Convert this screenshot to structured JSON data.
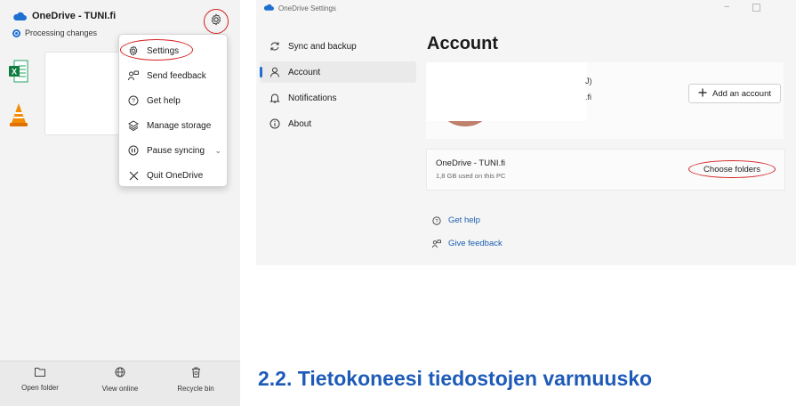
{
  "flyout": {
    "title": "OneDrive - TUNI.fi",
    "status": "Processing changes",
    "menu": {
      "items": [
        {
          "label": "Settings",
          "icon": "gear-icon"
        },
        {
          "label": "Send feedback",
          "icon": "feedback-icon"
        },
        {
          "label": "Get help",
          "icon": "help-icon"
        },
        {
          "label": "Manage storage",
          "icon": "storage-icon"
        },
        {
          "label": "Pause syncing",
          "icon": "pause-icon"
        },
        {
          "label": "Quit OneDrive",
          "icon": "close-icon"
        }
      ]
    },
    "bottom": [
      {
        "label": "Open folder",
        "icon": "folder-icon"
      },
      {
        "label": "View online",
        "icon": "globe-icon"
      },
      {
        "label": "Recycle bin",
        "icon": "recycle-bin-icon"
      }
    ],
    "files": [
      {
        "icon": "excel-file-icon"
      },
      {
        "icon": "vlc-file-icon"
      }
    ]
  },
  "settings": {
    "window_title": "OneDrive Settings",
    "nav": [
      {
        "label": "Sync and backup",
        "icon": "sync-icon"
      },
      {
        "label": "Account",
        "icon": "person-icon"
      },
      {
        "label": "Notifications",
        "icon": "bell-icon"
      },
      {
        "label": "About",
        "icon": "info-icon"
      }
    ],
    "heading": "Account",
    "account_fragment_1": "J)",
    "account_fragment_2": ".fi",
    "add_account": "Add an account",
    "onedrive_name": "OneDrive - TUNI.fi",
    "usage": "1,8 GB used on this PC",
    "choose_folders": "Choose folders",
    "links": {
      "get_help": "Get help",
      "give_feedback": "Give feedback"
    }
  },
  "doc_heading": "2.2. Tietokoneesi tiedostojen varmuusko",
  "colors": {
    "accent": "#1f6fd1",
    "highlight_ring": "#d42020",
    "heading_blue": "#1e5bb8"
  }
}
